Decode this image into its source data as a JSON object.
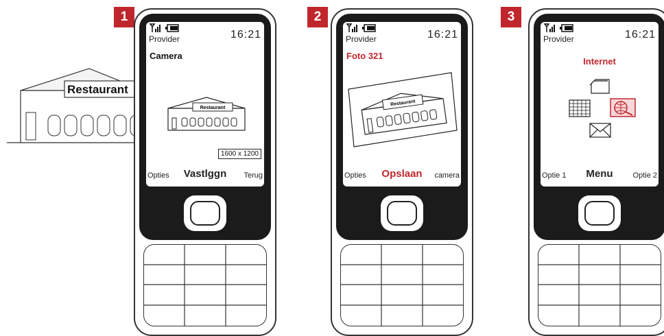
{
  "steps": [
    {
      "number": "1",
      "provider": "Provider",
      "time": "16:21",
      "title": "Camera",
      "resolution": "1600 x 1200",
      "softkeys": {
        "left": "Opties",
        "center": "Vastlggn",
        "right": "Terug"
      }
    },
    {
      "number": "2",
      "provider": "Provider",
      "time": "16:21",
      "title": "Foto 321",
      "softkeys": {
        "left": "Opties",
        "center": "Opslaan",
        "right": "camera"
      }
    },
    {
      "number": "3",
      "provider": "Provider",
      "time": "16:21",
      "title": "Internet",
      "softkeys": {
        "left": "Optie 1",
        "center": "Menu",
        "right": "Optie 2"
      }
    }
  ],
  "scene": {
    "building_sign": "Restaurant"
  },
  "colors": {
    "accent": "#c0272d",
    "screen_bg": "#1b1b1b"
  },
  "icons": [
    "signal-icon",
    "battery-icon",
    "folder-icon",
    "calendar-icon",
    "globe-icon",
    "envelope-icon"
  ]
}
